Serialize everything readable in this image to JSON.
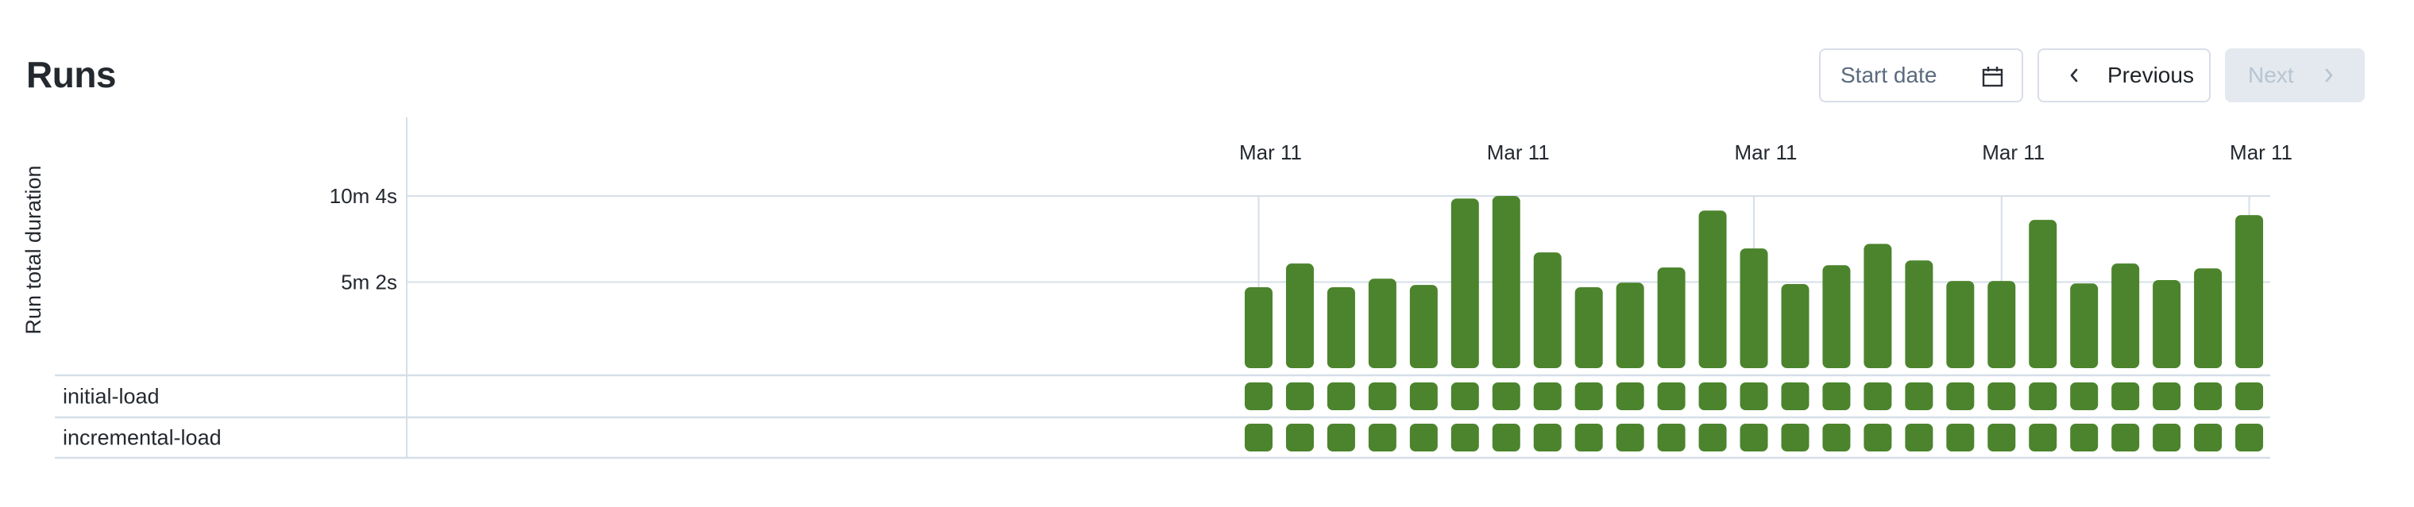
{
  "header": {
    "title": "Runs",
    "start_date_placeholder": "Start date",
    "previous_label": "Previous",
    "next_label": "Next",
    "next_disabled": true
  },
  "icons": {
    "calendar": "calendar-icon",
    "previous": "chevron-left-icon",
    "next": "chevron-right-icon"
  },
  "colors": {
    "bar": "#4b842c",
    "grid": "#d6dfe8",
    "text": "#24292f"
  },
  "chart_data": {
    "type": "bar",
    "title": "Runs",
    "ylabel": "Run total duration",
    "xlabel": "",
    "y_unit": "seconds",
    "ylim": [
      0,
      604
    ],
    "y_ticks": [
      {
        "value": 302,
        "label": "5m 2s"
      },
      {
        "value": 604,
        "label": "10m 4s"
      }
    ],
    "x_tick_labels": [
      {
        "bar_index": 0,
        "label": "Mar 11"
      },
      {
        "bar_index": 6,
        "label": "Mar 11"
      },
      {
        "bar_index": 12,
        "label": "Mar 11"
      },
      {
        "bar_index": 18,
        "label": "Mar 11"
      },
      {
        "bar_index": 24,
        "label": "Mar 11"
      }
    ],
    "grid": true,
    "values": [
      284,
      367,
      284,
      314,
      292,
      595,
      604,
      406,
      284,
      300,
      353,
      553,
      420,
      295,
      361,
      436,
      378,
      306,
      306,
      520,
      297,
      367,
      309,
      350,
      537
    ],
    "task_rows": [
      {
        "name": "initial-load",
        "status": [
          "success",
          "success",
          "success",
          "success",
          "success",
          "success",
          "success",
          "success",
          "success",
          "success",
          "success",
          "success",
          "success",
          "success",
          "success",
          "success",
          "success",
          "success",
          "success",
          "success",
          "success",
          "success",
          "success",
          "success",
          "success"
        ]
      },
      {
        "name": "incremental-load",
        "status": [
          "success",
          "success",
          "success",
          "success",
          "success",
          "success",
          "success",
          "success",
          "success",
          "success",
          "success",
          "success",
          "success",
          "success",
          "success",
          "success",
          "success",
          "success",
          "success",
          "success",
          "success",
          "success",
          "success",
          "success",
          "success"
        ]
      }
    ]
  }
}
